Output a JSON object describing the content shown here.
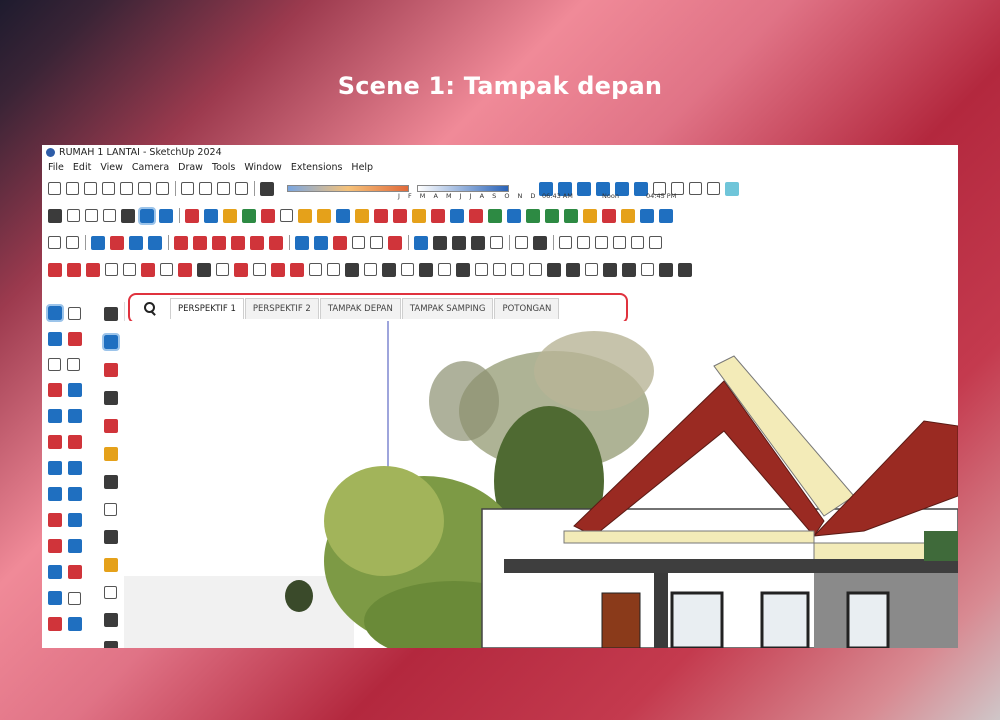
{
  "slide": {
    "heading": "Scene 1: Tampak depan"
  },
  "window": {
    "title": "RUMAH 1 LANTAI - SketchUp 2024"
  },
  "menu": [
    "File",
    "Edit",
    "View",
    "Camera",
    "Draw",
    "Tools",
    "Window",
    "Extensions",
    "Help"
  ],
  "shadow": {
    "months": "J F M A M J J A S O N D",
    "time_start": "06:43 AM",
    "time_noon": "Noon",
    "time_end": "04:45 PM"
  },
  "scenes": {
    "search_icon": "magnifier-icon",
    "tabs": [
      "PERSPEKTIF 1",
      "PERSPEKTIF 2",
      "TAMPAK DEPAN",
      "TAMPAK SAMPING",
      "POTONGAN"
    ],
    "active_index": 0
  },
  "colors": {
    "highlight": "#e0323e",
    "roof": "#9a2a22",
    "wall": "#ffffff",
    "trim": "#f3ebb8",
    "foliage": "#6e8a3f"
  }
}
